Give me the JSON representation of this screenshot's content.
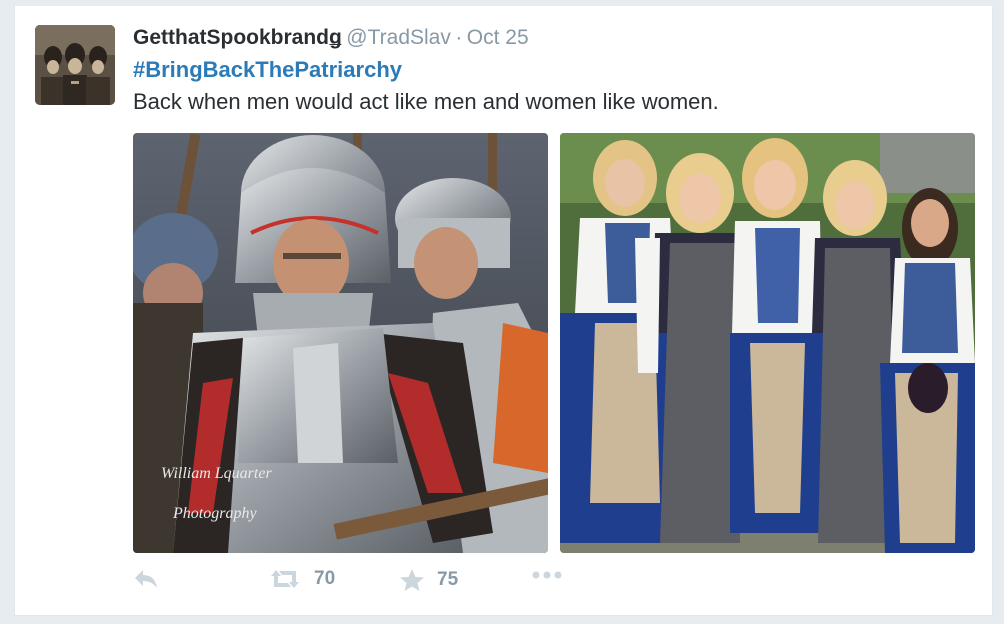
{
  "tweet": {
    "display_name": "GetthatSpookbrandǥ",
    "handle": "@TradSlav",
    "separator": "·",
    "date": "Oct 25",
    "hashtag": "#BringBackThePatriarchy",
    "text": "Back when men would act like men and women like women.",
    "media": {
      "left_watermark_line1": "William Lquarter",
      "left_watermark_line2": "Photography"
    }
  },
  "actions": {
    "reply_icon": "reply-icon",
    "retweet_icon": "retweet-icon",
    "retweet_count": "70",
    "favorite_icon": "star-icon",
    "favorite_count": "75",
    "more_icon": "more-dots-icon"
  },
  "colors": {
    "name": "#292f33",
    "meta": "#8899a6",
    "hashtag": "#2b7bb9",
    "icon": "#ccd6dd"
  }
}
